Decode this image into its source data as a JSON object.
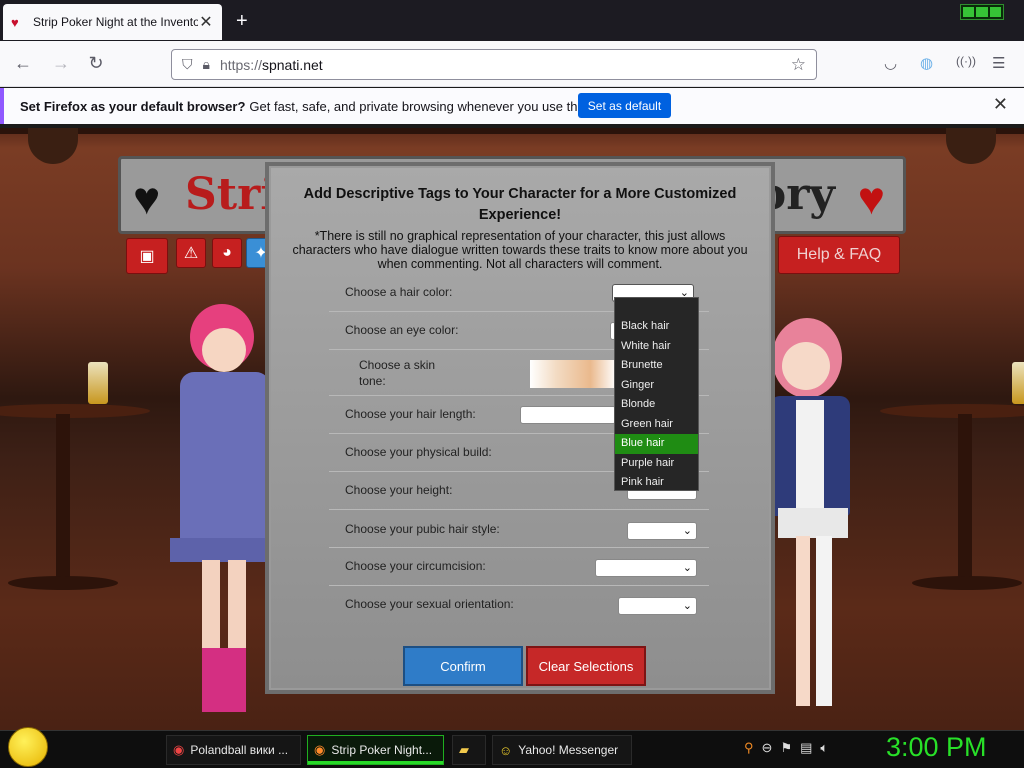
{
  "browser": {
    "tab_title": "Strip Poker Night at the Inventory",
    "url_scheme": "https://",
    "url_host": "spnati.net",
    "notification": {
      "bold": "Set Firefox as your default browser?",
      "text": "Get fast, safe, and private browsing whenever you use the web.",
      "button": "Set as default"
    }
  },
  "game": {
    "logo_left": "Strip",
    "logo_right": "ory",
    "help_button": "Help & FAQ"
  },
  "modal": {
    "title": "Add Descriptive Tags to Your Character for a More Customized Experience!",
    "note": "*There is still no graphical representation of your character, this just allows characters who have dialogue written towards these traits to know more about you when commenting. Not all characters will comment.",
    "rows": [
      {
        "label": "Choose a hair color:"
      },
      {
        "label": "Choose an eye color:"
      },
      {
        "label": "Choose a skin tone:"
      },
      {
        "label": "Choose your hair length:"
      },
      {
        "label": "Choose your physical build:"
      },
      {
        "label": "Choose your height:"
      },
      {
        "label": "Choose your pubic hair style:"
      },
      {
        "label": "Choose your circumcision:"
      },
      {
        "label": "Choose your sexual orientation:"
      }
    ],
    "hair_options": [
      "Black hair",
      "White hair",
      "Brunette",
      "Ginger",
      "Blonde",
      "Green hair",
      "Blue hair",
      "Purple hair",
      "Pink hair"
    ],
    "highlighted_option": "Blue hair",
    "confirm_label": "Confirm",
    "clear_label": "Clear Selections"
  },
  "taskbar": {
    "items": [
      {
        "icon": "chrome-icon",
        "label": "Polandball вики ..."
      },
      {
        "icon": "firefox-icon",
        "label": "Strip Poker Night..."
      },
      {
        "icon": "folder-icon",
        "label": ""
      },
      {
        "icon": "yahoo-smiley-icon",
        "label": "Yahoo! Messenger"
      }
    ],
    "clock": "3:00 PM"
  },
  "colors": {
    "accent_blue": "#0061e0",
    "confirm": "#2f7cc8",
    "clear": "#c62828",
    "dropdown_highlight": "#1f8c13",
    "clock": "#28e028"
  }
}
